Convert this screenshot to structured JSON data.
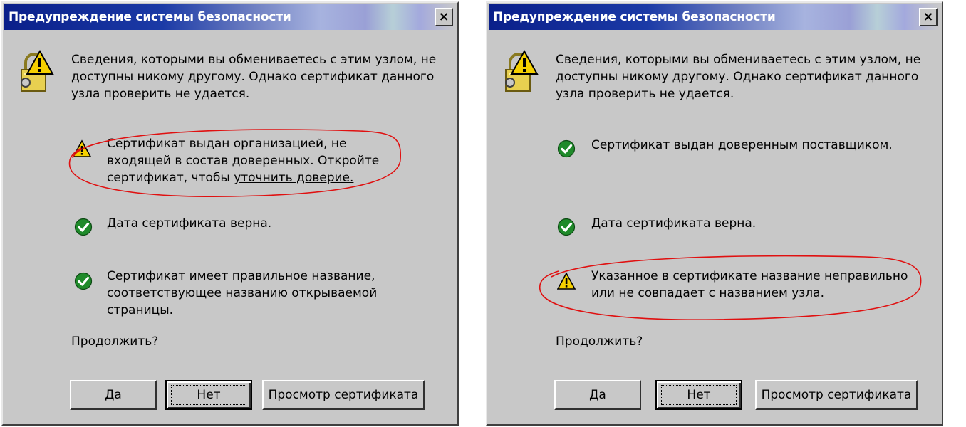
{
  "dialogs": [
    {
      "title": "Предупреждение системы безопасности",
      "close_label": "×",
      "intro": "Сведения, которыми вы обмениваетесь с этим узлом, не доступны никому другому. Однако сертификат данного узла проверить не удается.",
      "items": [
        {
          "status": "warning",
          "text_main": "Сертификат выдан организацией, не входящей в состав доверенных. Откройте сертификат, чтобы ",
          "text_underlined": "уточнить доверие."
        },
        {
          "status": "ok",
          "text": "Дата сертификата верна."
        },
        {
          "status": "ok",
          "text": "Сертификат имеет правильное название, соответствующее названию открываемой страницы."
        }
      ],
      "prompt": "Продолжить?",
      "buttons": {
        "yes": "Да",
        "no": "Нет",
        "view": "Просмотр сертификата"
      }
    },
    {
      "title": "Предупреждение системы безопасности",
      "close_label": "×",
      "intro": "Сведения, которыми вы обмениваетесь с этим узлом, не доступны никому другому. Однако сертификат данного узла проверить не удается.",
      "items": [
        {
          "status": "ok",
          "text": "Сертификат выдан доверенным поставщиком."
        },
        {
          "status": "ok",
          "text": "Дата сертификата верна."
        },
        {
          "status": "warning",
          "text": "Указанное в сертификате название неправильно или не совпадает с названием узла."
        }
      ],
      "prompt": "Продолжить?",
      "buttons": {
        "yes": "Да",
        "no": "Нет",
        "view": "Просмотр сертификата"
      }
    }
  ],
  "colors": {
    "dialog_bg": "#c8c8c8",
    "title_blue": "#0a1f8a",
    "warning_yellow": "#f5d000",
    "ok_green": "#1f8a2a",
    "annotation_red": "#e01010"
  },
  "icons": {
    "lock": "lock-warning-icon",
    "warning": "warning-icon",
    "ok": "check-circle-icon"
  }
}
